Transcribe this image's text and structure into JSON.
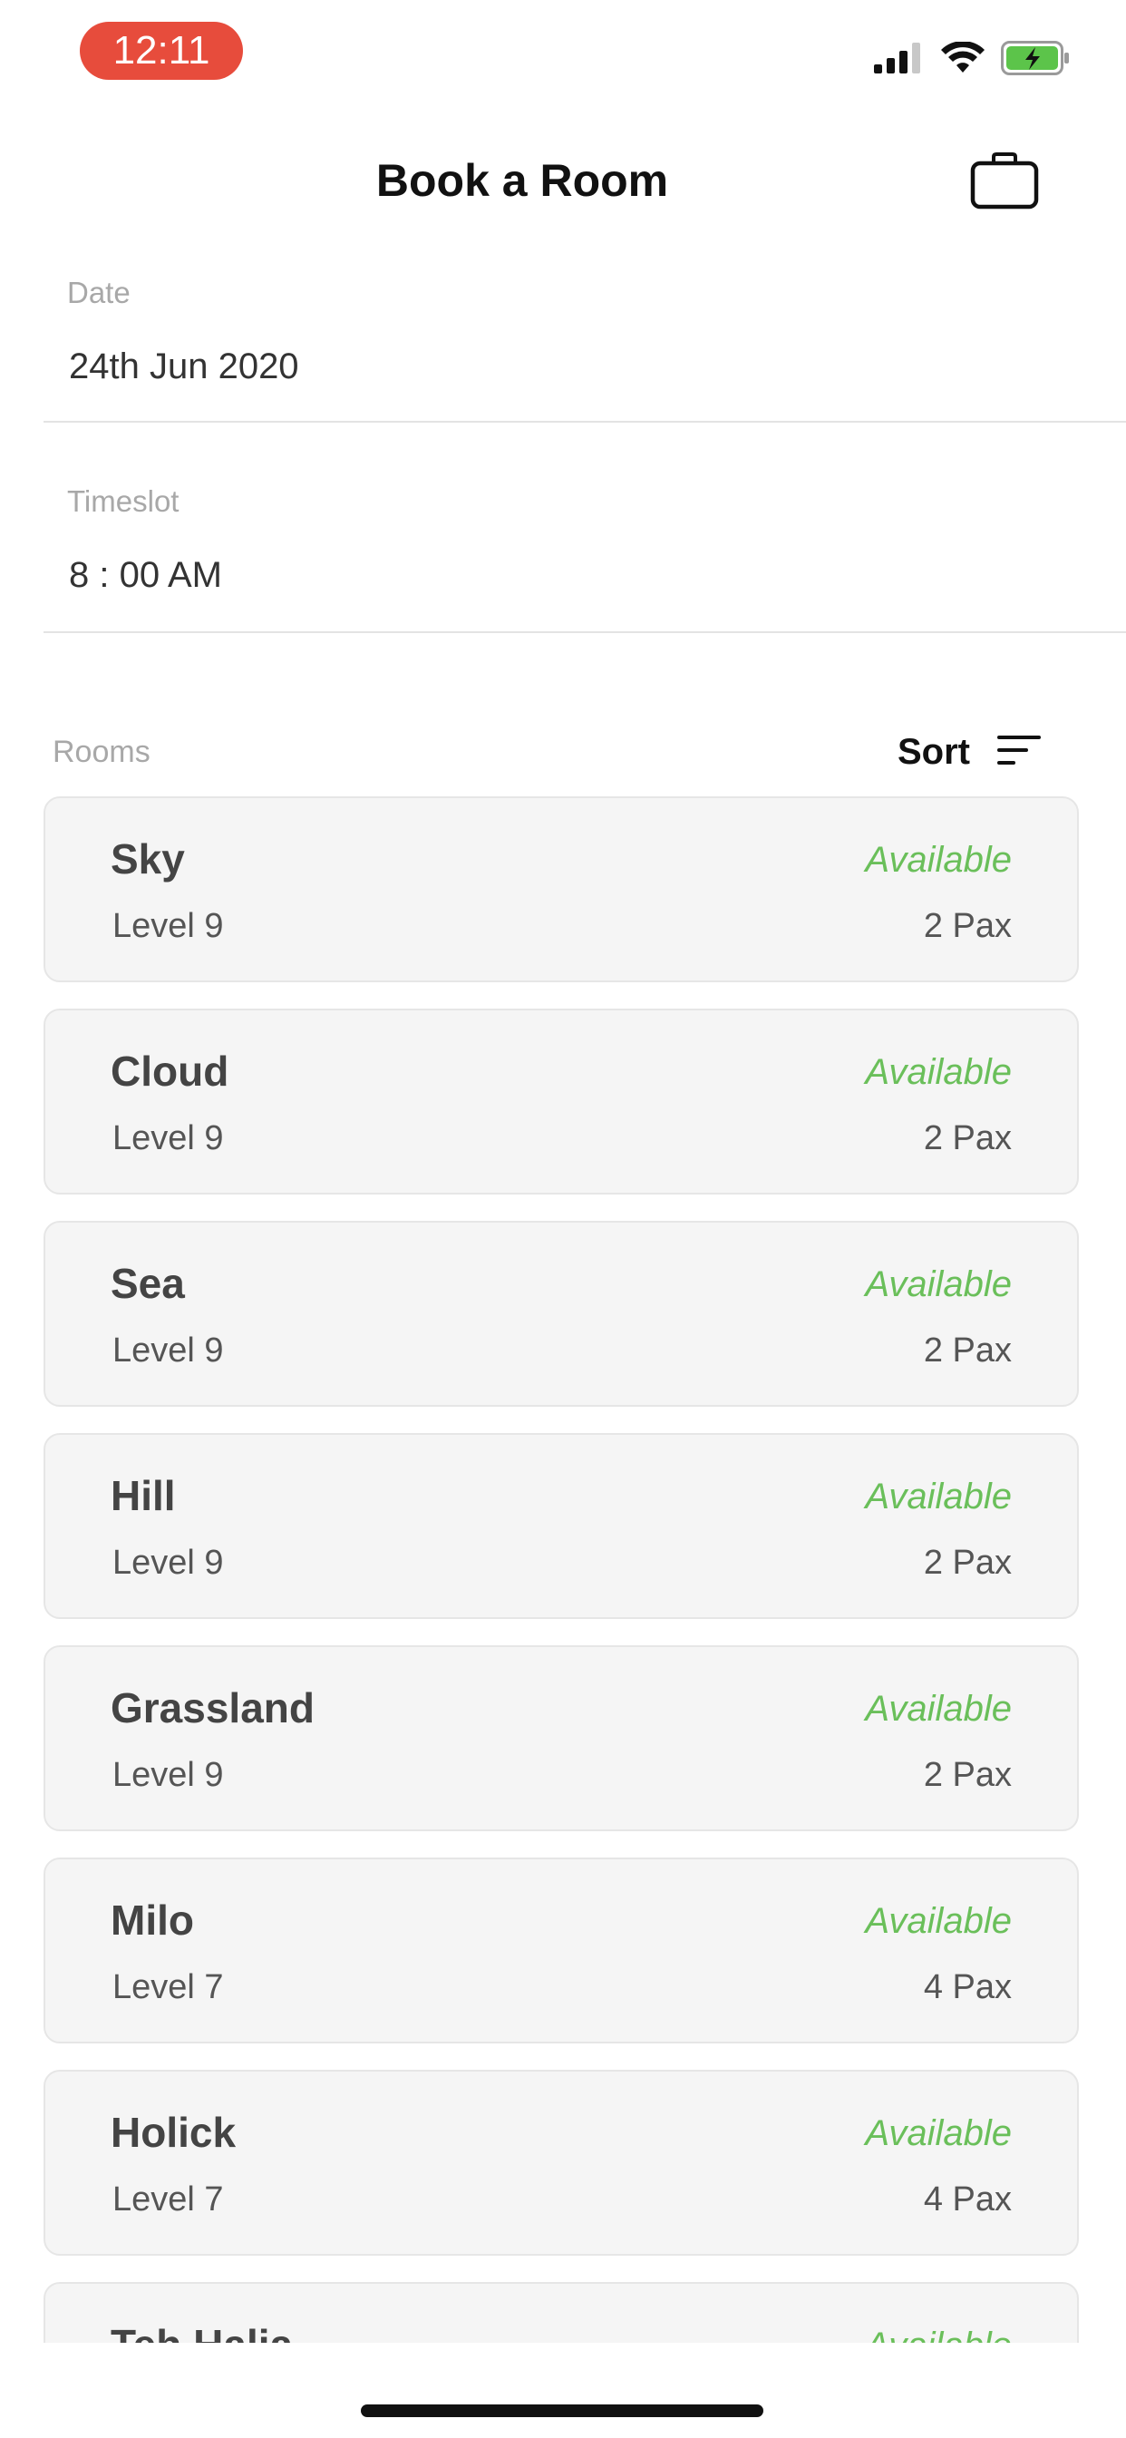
{
  "status_bar": {
    "time": "12:11",
    "icons": [
      "cellular-signal-icon",
      "wifi-icon",
      "battery-charging-icon"
    ],
    "time_pill_color": "#e74c3c",
    "battery_color": "#5cc44a"
  },
  "header": {
    "title": "Book a Room",
    "action_icon": "bag-icon"
  },
  "form": {
    "date_label": "Date",
    "date_value": "24th Jun 2020",
    "timeslot_label": "Timeslot",
    "timeslot_value": "8 : 00 AM"
  },
  "rooms_section": {
    "label": "Rooms",
    "sort_label": "Sort",
    "sort_icon": "sort-lines-icon"
  },
  "rooms": [
    {
      "name": "Sky",
      "level": "Level 9",
      "status": "Available",
      "pax": "2 Pax"
    },
    {
      "name": "Cloud",
      "level": "Level 9",
      "status": "Available",
      "pax": "2 Pax"
    },
    {
      "name": "Sea",
      "level": "Level 9",
      "status": "Available",
      "pax": "2 Pax"
    },
    {
      "name": "Hill",
      "level": "Level 9",
      "status": "Available",
      "pax": "2 Pax"
    },
    {
      "name": "Grassland",
      "level": "Level 9",
      "status": "Available",
      "pax": "2 Pax"
    },
    {
      "name": "Milo",
      "level": "Level 7",
      "status": "Available",
      "pax": "4 Pax"
    },
    {
      "name": "Holick",
      "level": "Level 7",
      "status": "Available",
      "pax": "4 Pax"
    },
    {
      "name": "Teh Halia",
      "level": "",
      "status": "Available",
      "pax": ""
    }
  ],
  "colors": {
    "available": "#6abf5a",
    "card_background": "#f5f5f5",
    "muted_label": "#a8a8a8"
  }
}
